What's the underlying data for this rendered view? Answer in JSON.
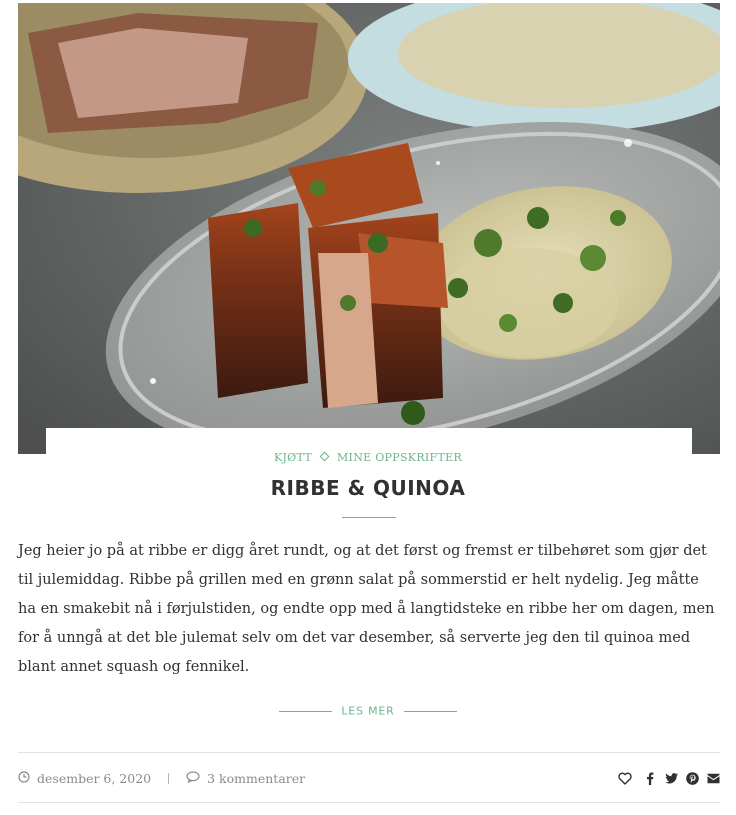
{
  "post": {
    "image_alt": "Ribbe med quinoa på et grått keramikkfat",
    "categories": [
      "KJØTT",
      "MINE OPPSKRIFTER"
    ],
    "title": "RIBBE & QUINOA",
    "excerpt": "Jeg heier jo på at ribbe er digg året rundt, og at det først og fremst er tilbehøret som gjør det til julemiddag. Ribbe på grillen med en grønn salat på sommerstid er helt nydelig. Jeg måtte ha en smakebit nå i førjulstiden, og endte opp med å langtidsteke en ribbe her om dagen, men for å unngå at det ble julemat selv om det var desember, så serverte jeg den til quinoa med blant annet squash og fennikel.",
    "read_more": "LES MER",
    "date": "desember 6, 2020",
    "comments": "3 kommentarer"
  },
  "icons": {
    "date": "clock-icon",
    "comments": "speech-bubble-icon",
    "like": "heart-icon",
    "share": [
      "facebook-icon",
      "twitter-icon",
      "pinterest-icon",
      "email-icon"
    ]
  },
  "colors": {
    "accent": "#6eb48c",
    "text": "#313131",
    "meta": "#8b8b8b"
  }
}
